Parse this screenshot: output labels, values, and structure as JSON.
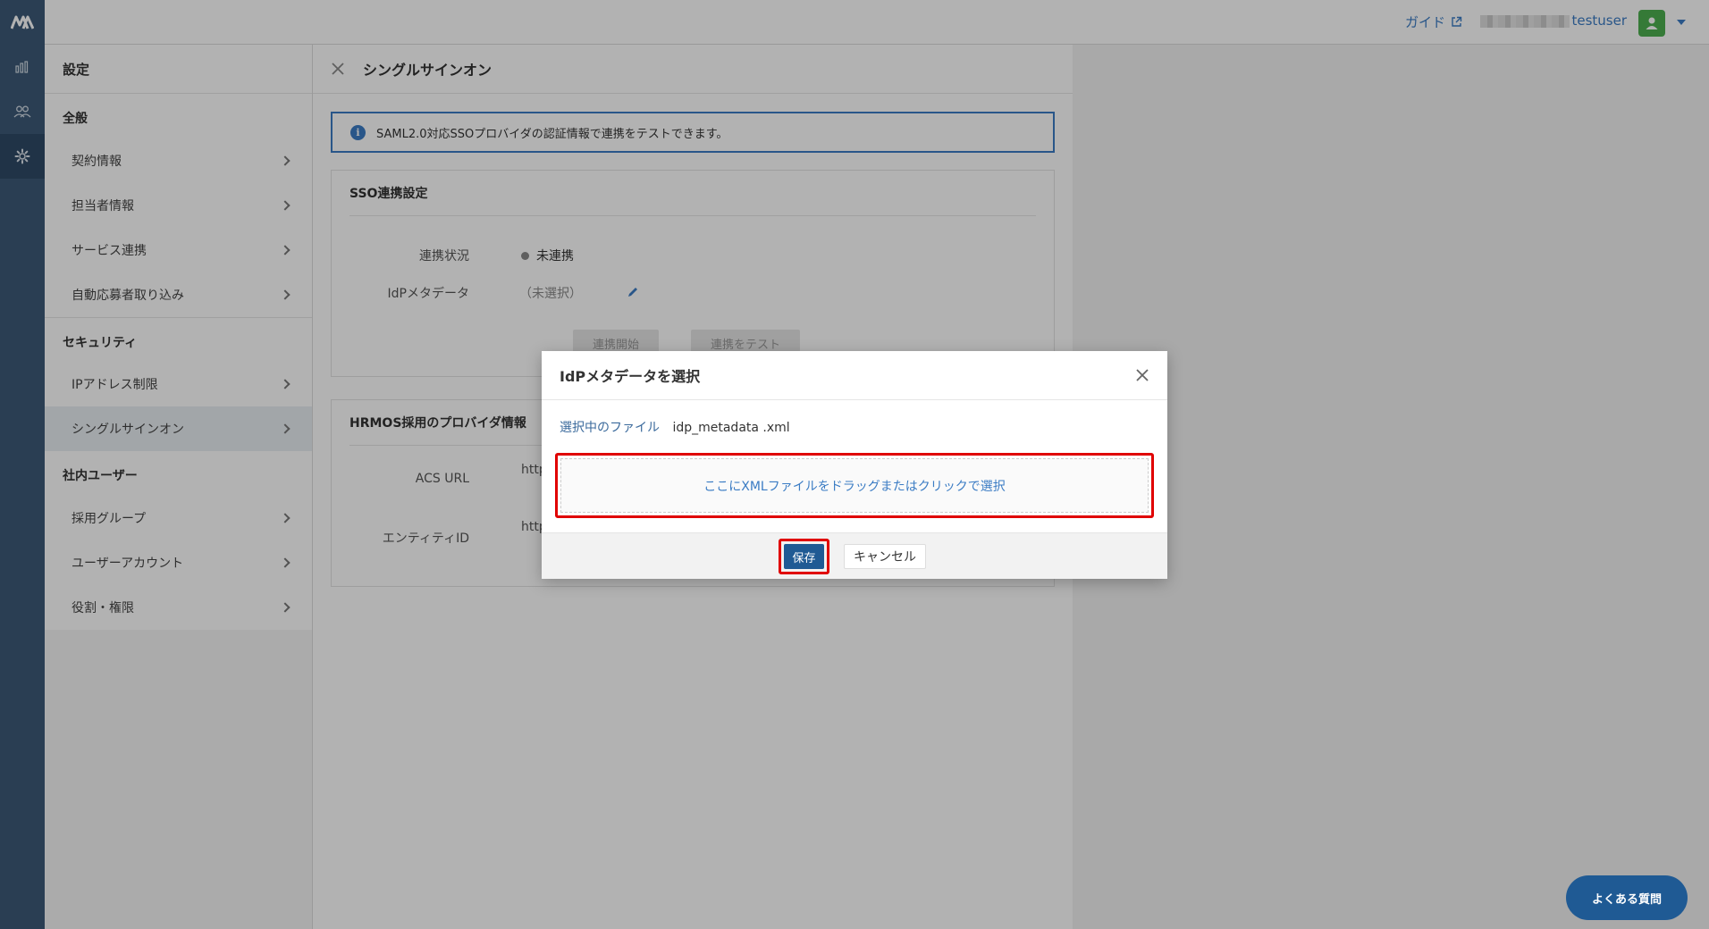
{
  "app": {
    "logo_text": "M"
  },
  "topbar": {
    "guide_label": "ガイド",
    "username": "testuser"
  },
  "sidebar": {
    "title": "設定",
    "sections": [
      {
        "label": "全般",
        "items": [
          "契約情報",
          "担当者情報",
          "サービス連携",
          "自動応募者取り込み"
        ]
      },
      {
        "label": "セキュリティ",
        "items": [
          "IPアドレス制限",
          "シングルサインオン"
        ]
      },
      {
        "label": "社内ユーザー",
        "items": [
          "採用グループ",
          "ユーザーアカウント",
          "役割・権限"
        ]
      }
    ]
  },
  "main": {
    "title": "シングルサインオン",
    "info_text": "SAML2.0対応SSOプロバイダの認証情報で連携をテストできます。",
    "sso": {
      "title": "SSO連携設定",
      "status_label": "連携状況",
      "status_value": "未連携",
      "metadata_label": "IdPメタデータ",
      "metadata_value": "（未選択）",
      "start_button": "連携開始",
      "test_button": "連携をテスト"
    },
    "provider": {
      "title": "HRMOS採用のプロバイダ情報",
      "acs_label": "ACS URL",
      "acs_value": "http",
      "entity_label": "エンティティID",
      "entity_value": "http"
    }
  },
  "modal": {
    "title": "IdPメタデータを選択",
    "selected_label": "選択中のファイル",
    "selected_file": "idp_metadata .xml",
    "drop_text": "ここにXMLファイルをドラッグまたはクリックで選択",
    "save_label": "保存",
    "cancel_label": "キャンセル"
  },
  "faq_label": "よくある質問"
}
